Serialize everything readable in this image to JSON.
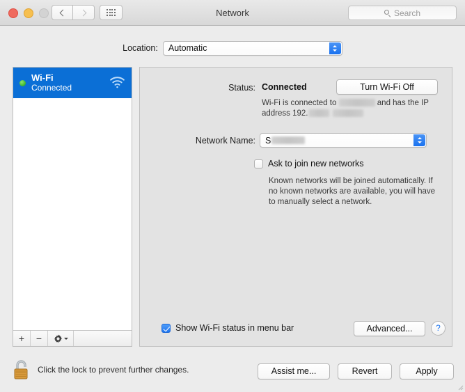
{
  "window": {
    "title": "Network",
    "traffic_lights": [
      "close",
      "minimize",
      "zoom"
    ],
    "search_placeholder": "Search"
  },
  "location": {
    "label": "Location:",
    "value": "Automatic"
  },
  "sidebar": {
    "services": [
      {
        "name": "Wi-Fi",
        "status": "Connected",
        "indicator": "green",
        "icon": "wifi-icon",
        "selected": true
      }
    ],
    "toolbar": {
      "add_label": "+",
      "remove_label": "−",
      "action_icon": "gear-icon"
    }
  },
  "detail": {
    "status": {
      "label": "Status:",
      "value": "Connected",
      "toggle_button": "Turn Wi-Fi Off",
      "description_prefix": "Wi-Fi is connected to",
      "description_middle": "and has the IP",
      "description_ip_prefix": "address 192.",
      "redacted_network": "",
      "redacted_ip_1": "",
      "redacted_ip_2": ""
    },
    "network_name": {
      "label": "Network Name:",
      "value_visible": "S",
      "value_redacted": ""
    },
    "ask_to_join": {
      "label": "Ask to join new networks",
      "checked": false,
      "help_text": "Known networks will be joined automatically. If no known networks are available, you will have to manually select a network."
    },
    "footer": {
      "show_status_label": "Show Wi-Fi status in menu bar",
      "show_status_checked": true,
      "advanced_button": "Advanced...",
      "help_button": "?"
    }
  },
  "window_footer": {
    "lock_icon": "unlocked-padlock-icon",
    "lock_text": "Click the lock to prevent further changes.",
    "assist_button": "Assist me...",
    "revert_button": "Revert",
    "apply_button": "Apply"
  },
  "colors": {
    "selection_blue": "#0b6fd6",
    "accent_blue": "#1f74ef",
    "panel_gray": "#e3e3e3",
    "window_gray": "#ececec",
    "status_green": "#39b52a",
    "lock_gold": "#d9913a"
  }
}
